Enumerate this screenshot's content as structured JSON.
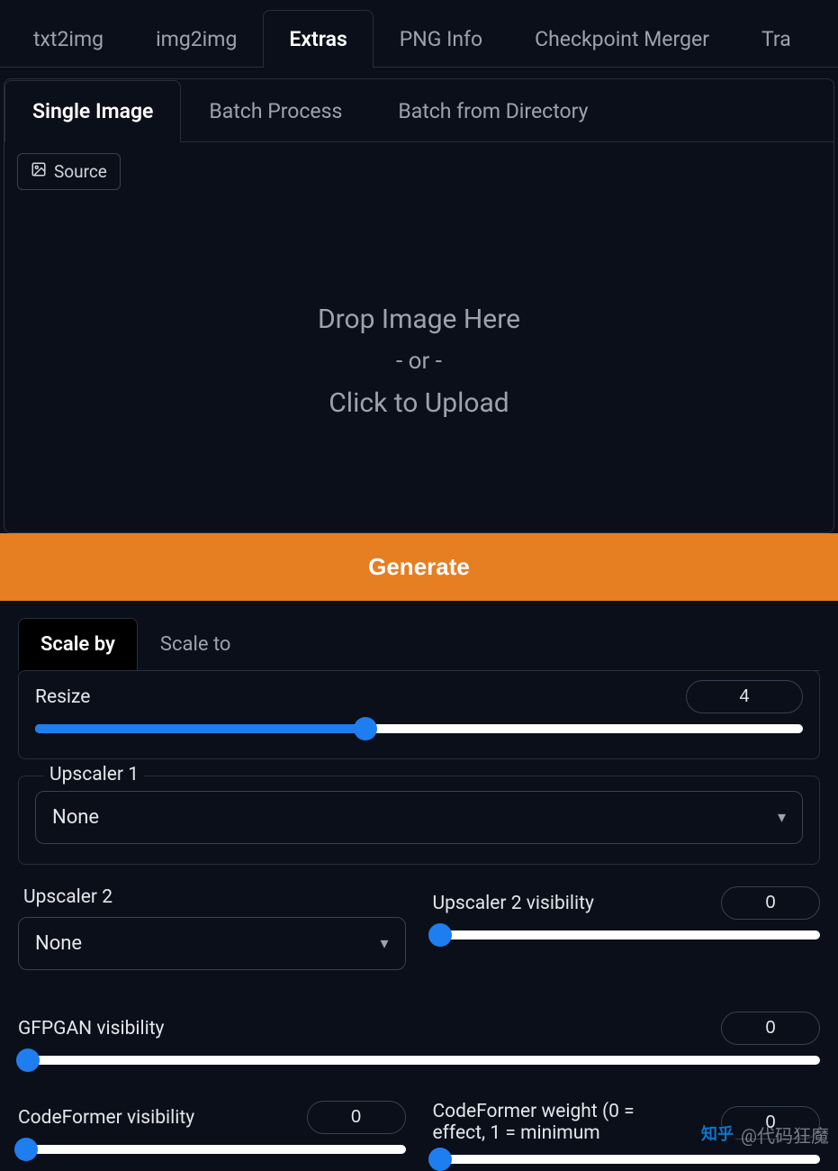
{
  "topTabs": {
    "t0": "txt2img",
    "t1": "img2img",
    "t2": "Extras",
    "t3": "PNG Info",
    "t4": "Checkpoint Merger",
    "t5": "Tra"
  },
  "subTabs": {
    "s0": "Single Image",
    "s1": "Batch Process",
    "s2": "Batch from Directory"
  },
  "source": {
    "label": "Source"
  },
  "dropzone": {
    "line1": "Drop Image Here",
    "line2": "- or -",
    "line3": "Click to Upload"
  },
  "generate": {
    "label": "Generate"
  },
  "scaleTabs": {
    "by": "Scale by",
    "to": "Scale to"
  },
  "resize": {
    "label": "Resize",
    "value": "4",
    "min": 1,
    "max": 8,
    "percent": 43
  },
  "upscaler1": {
    "label": "Upscaler 1",
    "value": "None"
  },
  "upscaler2": {
    "label": "Upscaler 2",
    "value": "None"
  },
  "up2vis": {
    "label": "Upscaler 2 visibility",
    "value": "0",
    "percent": 0
  },
  "gfpgan": {
    "label": "GFPGAN visibility",
    "value": "0",
    "percent": 0
  },
  "codeformer_vis": {
    "label": "CodeFormer visibility",
    "value": "0",
    "percent": 0
  },
  "codeformer_weight": {
    "label": "CodeFormer weight (0 = effect, 1 = minimum",
    "value": "0",
    "percent": 0
  },
  "watermark": {
    "logo": "知乎",
    "text": "@代码狂魔"
  }
}
